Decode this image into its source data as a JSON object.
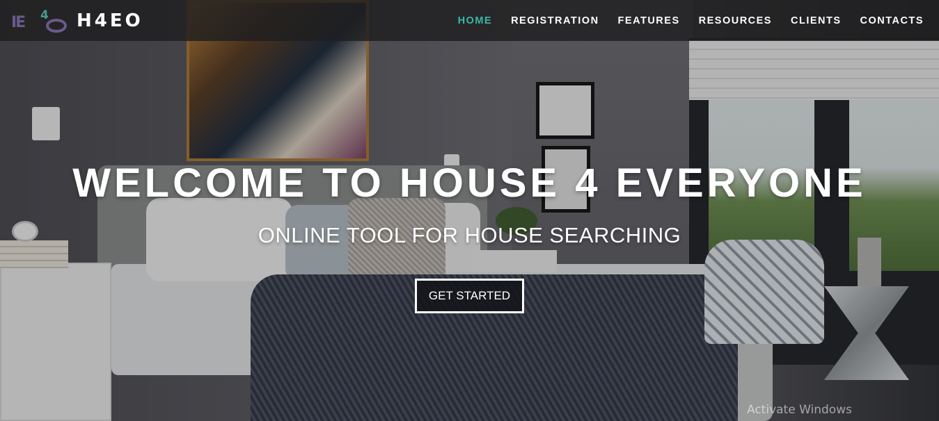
{
  "brand": {
    "logo_mark": "H4EO",
    "name": "H4EO"
  },
  "nav": {
    "items": [
      {
        "label": "HOME",
        "active": true
      },
      {
        "label": "REGISTRATION",
        "active": false
      },
      {
        "label": "FEATURES",
        "active": false
      },
      {
        "label": "RESOURCES",
        "active": false
      },
      {
        "label": "CLIENTS",
        "active": false
      },
      {
        "label": "CONTACTS",
        "active": false
      }
    ]
  },
  "hero": {
    "headline": "WELCOME TO HOUSE 4 EVERYONE",
    "subheadline": "ONLINE TOOL FOR HOUSE SEARCHING",
    "cta_label": "GET STARTED",
    "background_image": "bedroom-photo"
  },
  "system": {
    "watermark": "Activate Windows"
  },
  "colors": {
    "accent": "#39b7a6",
    "nav_bg": "#1e1e20",
    "text": "#ffffff",
    "logo_purple": "#6a5a8c"
  }
}
